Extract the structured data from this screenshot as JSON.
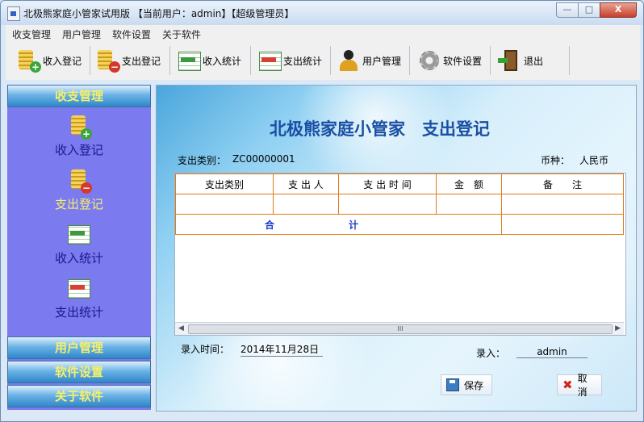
{
  "window": {
    "title": "北极熊家庭小管家试用版 【当前用户：admin】【超级管理员】",
    "min_label": "—",
    "max_label": "□",
    "close_label": "X"
  },
  "menu": [
    "收支管理",
    "用户管理",
    "软件设置",
    "关于软件"
  ],
  "toolbar": {
    "income_register": "收入登记",
    "expense_register": "支出登记",
    "income_stats": "收入统计",
    "expense_stats": "支出统计",
    "user_manage": "用户管理",
    "software_settings": "软件设置",
    "exit": "退出"
  },
  "sidebar": {
    "header": "收支管理",
    "items": [
      {
        "label": "收入登记",
        "color": "#1a1a8c"
      },
      {
        "label": "支出登记",
        "color": "#f5f06a"
      },
      {
        "label": "收入统计",
        "color": "#1a1a8c"
      },
      {
        "label": "支出统计",
        "color": "#1a1a8c"
      }
    ],
    "sections": [
      "用户管理",
      "软件设置",
      "关于软件"
    ]
  },
  "form": {
    "title": "北极熊家庭小管家　支出登记",
    "category_label": "支出类别：",
    "category_value": "ZC00000001",
    "currency_label": "币种：",
    "currency_value": "人民币",
    "table_headers": [
      "支出类别",
      "支 出 人",
      "支 出 时 间",
      "金　额",
      "备　　注"
    ],
    "total_left": "合",
    "total_right": "计",
    "scroll_grip": "III",
    "entry_time_label": "录入时间：",
    "entry_time_value": "2014年11月28日",
    "entry_user_label": "录入：",
    "entry_user_value": "admin",
    "save_label": "保存",
    "cancel_label": "取消"
  },
  "colors": {
    "accent": "#1a4fa3",
    "sidebar_bg": "#7b7bef",
    "grid_border": "#e07a1a",
    "active_item": "#f5f06a"
  }
}
